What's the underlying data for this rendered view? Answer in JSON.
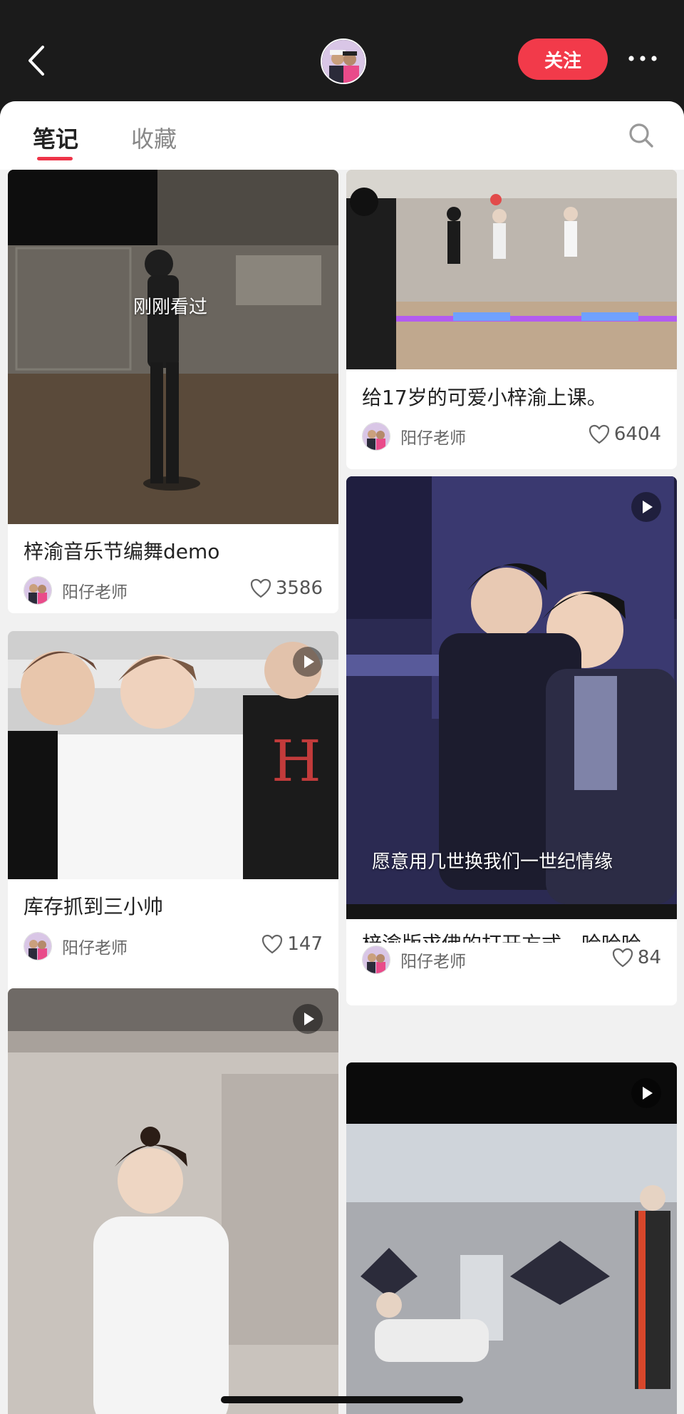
{
  "header": {
    "follow_label": "关注",
    "back_icon": "chevron-left-icon",
    "more_icon": "more-horizontal-icon"
  },
  "tabs": [
    {
      "label": "笔记",
      "active": true
    },
    {
      "label": "收藏",
      "active": false
    }
  ],
  "colors": {
    "accent": "#f23a4a",
    "background": "#1b1b1b",
    "sheet": "#f1f1f1"
  },
  "feed": {
    "left": [
      {
        "title": "梓渝音乐节编舞demo",
        "author": "阳仔老师",
        "likes": "3586",
        "overlay": "刚刚看过",
        "video": false
      },
      {
        "title": "库存抓到三小帅",
        "author": "阳仔老师",
        "likes": "147",
        "video": true
      },
      {
        "video": true
      }
    ],
    "right": [
      {
        "title": "给17岁的可爱小梓渝上课。",
        "author": "阳仔老师",
        "likes": "6404",
        "video": false
      },
      {
        "title": "梓渝版求佛的打开方式。哈哈哈",
        "author": "阳仔老师",
        "likes": "84",
        "caption": "愿意用几世换我们一世纪情缘",
        "video": true
      },
      {
        "video": true
      }
    ]
  }
}
